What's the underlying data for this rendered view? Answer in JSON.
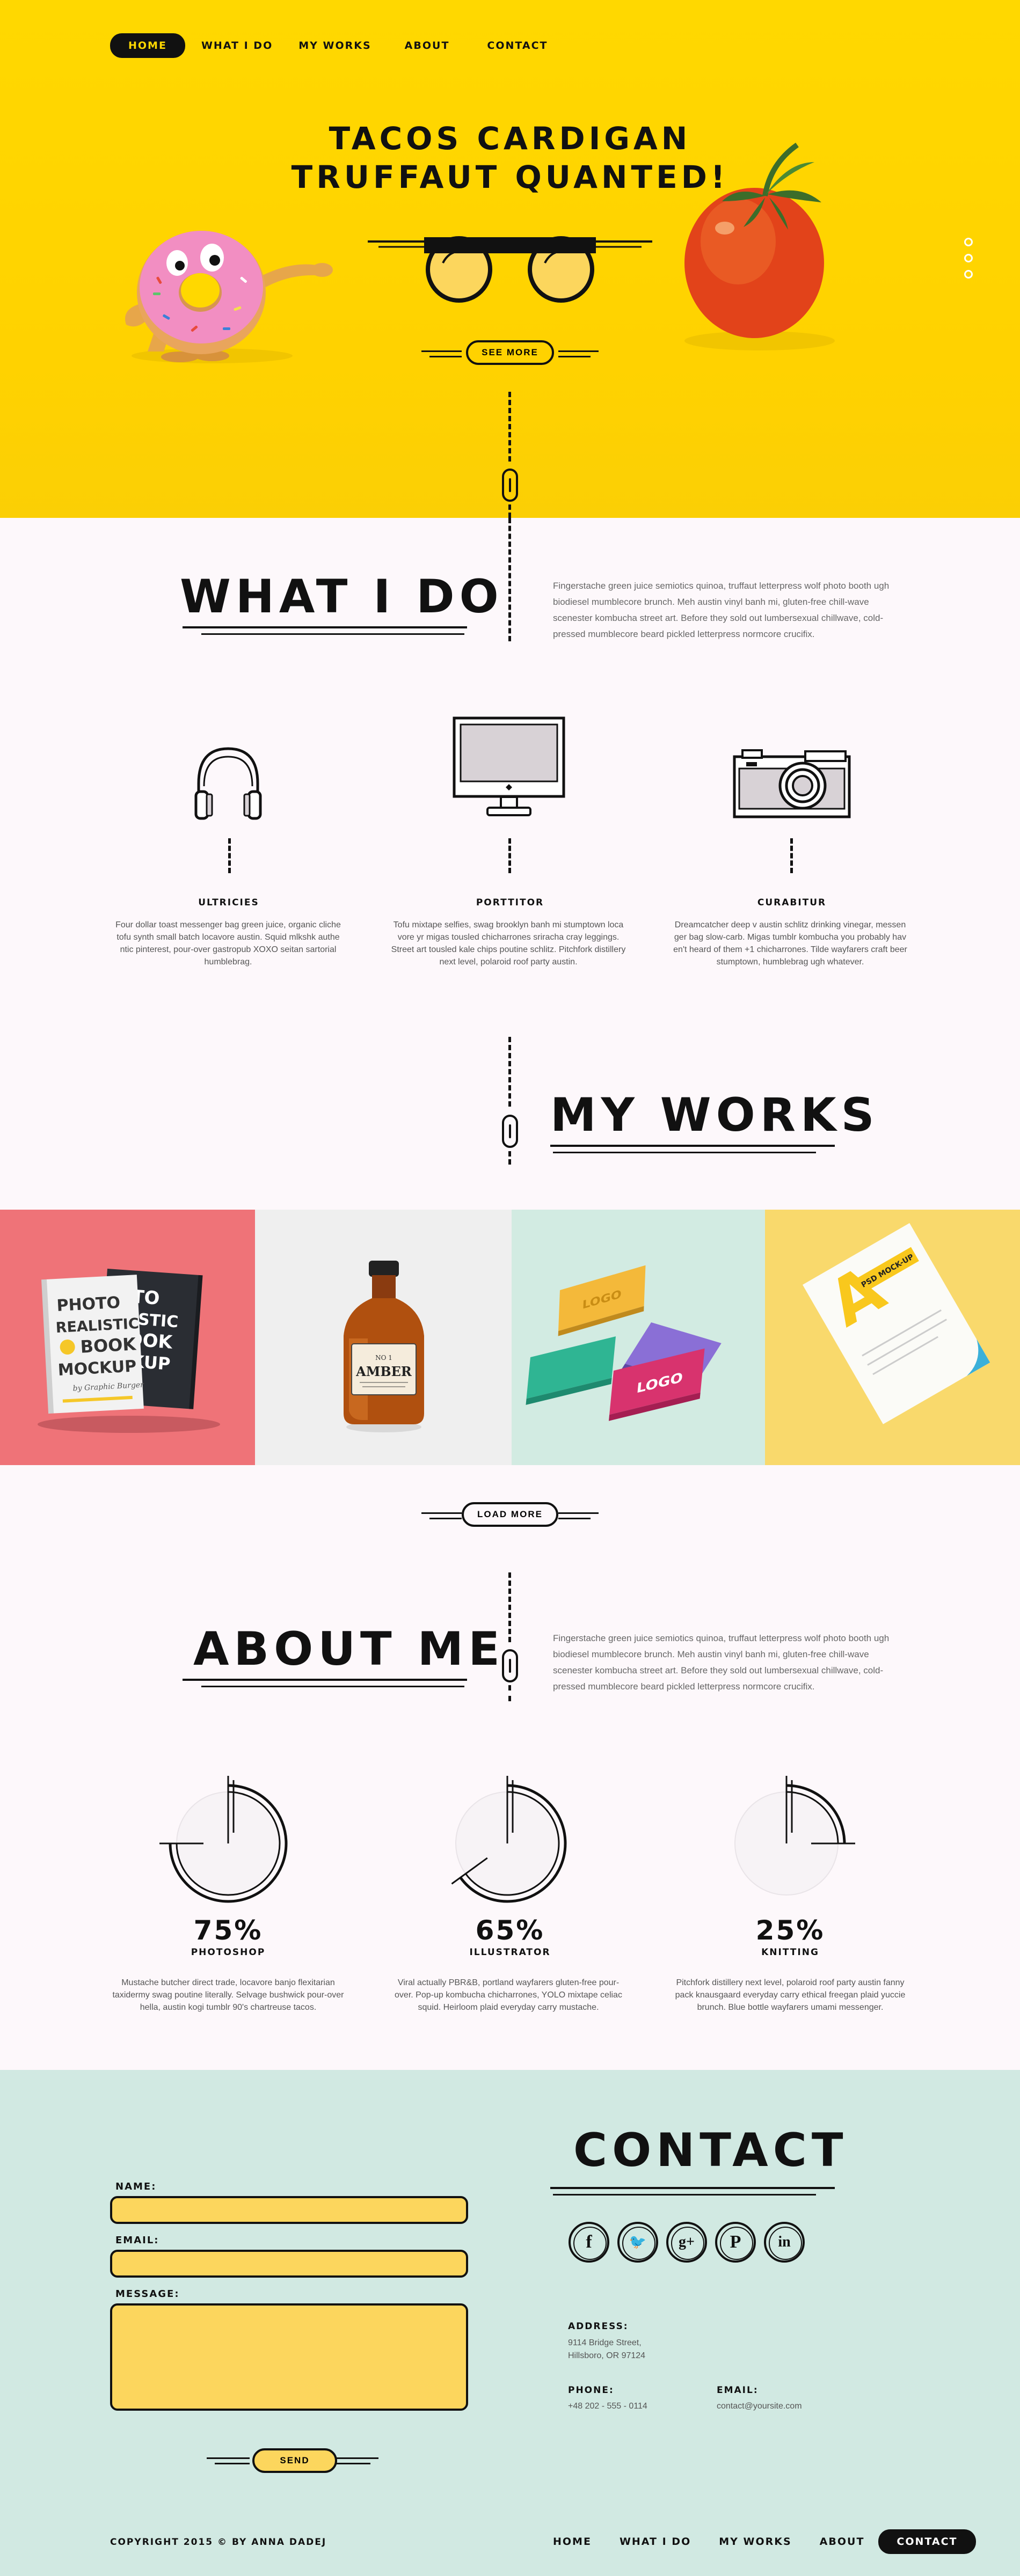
{
  "nav": {
    "items": [
      {
        "label": "HOME",
        "active": true
      },
      {
        "label": "WHAT I DO",
        "active": false
      },
      {
        "label": "MY WORKS",
        "active": false
      },
      {
        "label": "ABOUT",
        "active": false
      },
      {
        "label": "CONTACT",
        "active": false
      }
    ]
  },
  "hero": {
    "title_line1": "TACOS CARDIGAN",
    "title_line2": "TRUFFAUT QUANTED!",
    "cta_label": "SEE MORE",
    "slider_dots": 3
  },
  "what_i_do": {
    "title": "WHAT I DO",
    "description": "Fingerstache green juice semiotics quinoa, truffaut letterpress wolf photo booth ugh biodiesel mumblecore brunch. Meh austin vinyl banh mi, gluten-free chill-wave scenester kombucha street art. Before they sold out lumbersexual chillwave, cold-pressed mumblecore beard pickled letterpress normcore crucifix.",
    "services": [
      {
        "icon": "headphones-icon",
        "title": "ULTRICIES",
        "text": "Four dollar toast messenger bag green juice, organic cliche tofu synth small batch locavore austin. Squid mlkshk authe ntic pinterest, pour-over gastropub XOXO seitan sartorial humblebrag."
      },
      {
        "icon": "monitor-icon",
        "title": "PORTTITOR",
        "text": "Tofu mixtape selfies, swag brooklyn banh mi stumptown loca vore yr migas tousled chicharrones sriracha cray leggings. Street art tousled kale chips poutine schlitz. Pitchfork distillery next level, polaroid roof party austin."
      },
      {
        "icon": "camera-icon",
        "title": "CURABITUR",
        "text": "Dreamcatcher deep v austin schlitz drinking vinegar, messen ger bag slow-carb. Migas tumblr kombucha you probably hav en't heard of them +1 chicharrones. Tilde wayfarers craft beer stumptown, humblebrag ugh whatever."
      }
    ]
  },
  "works": {
    "title": "MY WORKS",
    "load_more_label": "LOAD MORE",
    "items": [
      {
        "name": "photo-realistic-book-mockup",
        "bg": "#ef7378",
        "book_lines": [
          "PHOTO",
          "REALISTIC",
          "BOOK",
          "MOCKUP"
        ],
        "book_sub": "by Graphic Burger"
      },
      {
        "name": "amber-bottle-mockup",
        "bg": "#efefef",
        "label_text": "AMBER",
        "label_small": "NO 1"
      },
      {
        "name": "business-card-mockup",
        "bg": "#d2ebe2",
        "logo_text": "LOGO"
      },
      {
        "name": "letterhead-psd-mockup",
        "bg": "#f9d96c",
        "badge_text": "PSD MOCK-UP",
        "letter": "A"
      }
    ]
  },
  "about": {
    "title": "ABOUT ME",
    "description": "Fingerstache green juice semiotics quinoa, truffaut letterpress wolf photo booth ugh biodiesel mumblecore brunch. Meh austin vinyl banh mi, gluten-free chill-wave scenester kombucha street art. Before they sold out lumbersexual chillwave, cold-pressed mumblecore beard pickled letterpress normcore crucifix.",
    "skills": [
      {
        "percent": 75,
        "percent_label": "75%",
        "name": "PHOTOSHOP",
        "text": "Mustache butcher direct trade, locavore banjo flexitarian taxidermy swag poutine literally. Selvage bushwick pour-over hella, austin kogi tumblr 90's chartreuse tacos."
      },
      {
        "percent": 65,
        "percent_label": "65%",
        "name": "ILLUSTRATOR",
        "text": "Viral actually PBR&B, portland wayfarers gluten-free pour-over. Pop-up kombucha chicharrones, YOLO mixtape celiac squid. Heirloom plaid everyday carry mustache."
      },
      {
        "percent": 25,
        "percent_label": "25%",
        "name": "KNITTING",
        "text": "Pitchfork distillery next level, polaroid roof party austin fanny pack knausgaard everyday carry ethical freegan plaid yuccie brunch. Blue bottle wayfarers umami messenger."
      }
    ]
  },
  "contact": {
    "title": "CONTACT",
    "form": {
      "name_label": "NAME:",
      "email_label": "EMAIL:",
      "message_label": "MESSAGE:",
      "name_value": "",
      "email_value": "",
      "message_value": "",
      "send_label": "SEND"
    },
    "socials": [
      {
        "icon": "facebook-icon",
        "glyph": "f"
      },
      {
        "icon": "twitter-icon",
        "glyph": "🐦"
      },
      {
        "icon": "google-plus-icon",
        "glyph": "g+"
      },
      {
        "icon": "pinterest-icon",
        "glyph": "P"
      },
      {
        "icon": "linkedin-icon",
        "glyph": "in"
      }
    ],
    "address_label": "ADDRESS:",
    "address_line1": "9114 Bridge Street,",
    "address_line2": "Hillsboro, OR 97124",
    "phone_label": "PHONE:",
    "phone_value": "+48 202 - 555 - 0114",
    "email_info_label": "EMAIL:",
    "email_info_value": "contact@yoursite.com"
  },
  "footer": {
    "copyright": "COPYRIGHT 2015 © BY ANNA DADEJ",
    "nav": [
      {
        "label": "HOME",
        "active": false
      },
      {
        "label": "WHAT I DO",
        "active": false
      },
      {
        "label": "MY WORKS",
        "active": false
      },
      {
        "label": "ABOUT",
        "active": false
      },
      {
        "label": "CONTACT",
        "active": true
      }
    ]
  },
  "colors": {
    "hero_yellow": "#ffd800",
    "page_bg": "#fdf8fb",
    "contact_bg": "#d1e9e2",
    "field_yellow": "#fcd65d",
    "ink": "#111111"
  }
}
